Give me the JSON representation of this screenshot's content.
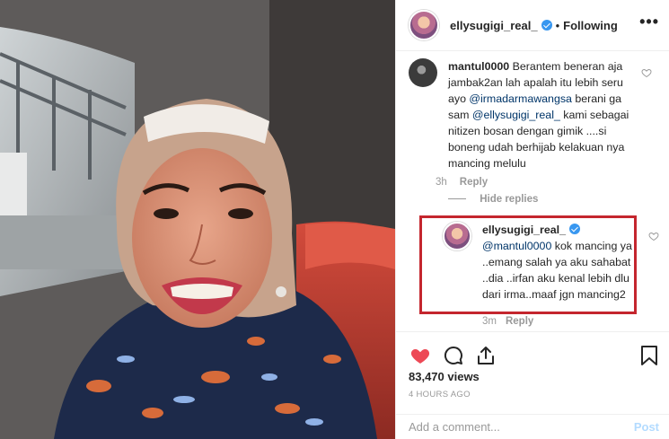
{
  "header": {
    "username": "ellysugigi_real_",
    "separator": "•",
    "follow_status": "Following",
    "more_label": "•••"
  },
  "comments": [
    {
      "username": "mantul0000",
      "text_parts": [
        "Berantem beneran aja jambak2an lah apalah itu lebih seru ayo ",
        "@irmadarmawangsa",
        " berani ga sam ",
        "@ellysugigi_real_",
        " kami sebagai nitizen bosan dengan gimik ....si boneng udah berhijab kelakuan nya mancing melulu"
      ],
      "time": "3h",
      "reply_label": "Reply",
      "hide_replies_label": "Hide replies"
    },
    {
      "username": "ellysugigi_real_",
      "mention": "@mantul0000",
      "text": " kok mancing ya ..emang salah ya aku sahabat ..dia ..irfan aku kenal lebih dlu dari irma..maaf jgn mancing2",
      "time": "3m",
      "reply_label": "Reply"
    }
  ],
  "actions": {
    "likes_label": "83,470 views",
    "time_label": "4 HOURS AGO",
    "add_comment_placeholder": "Add a comment...",
    "post_label": "Post"
  },
  "colors": {
    "like_red": "#ed4956",
    "highlight_box": "#c4262e",
    "link_blue": "#003569",
    "verified_blue": "#3897f0"
  }
}
